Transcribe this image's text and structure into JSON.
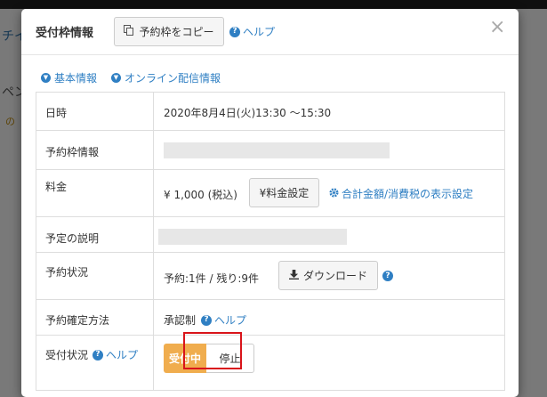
{
  "background": {
    "fragments": [
      "チイ",
      "ペン",
      "の"
    ]
  },
  "modal": {
    "title": "受付枠情報",
    "copy_button": "予約枠をコピー",
    "help_label": "ヘルプ",
    "close_symbol": "×",
    "anchor_links": [
      "基本情報",
      "オンライン配信情報"
    ]
  },
  "table": {
    "datetime": {
      "label": "日時",
      "value": "2020年8月4日(火)13:30 ～15:30"
    },
    "slot_info": {
      "label": "予約枠情報"
    },
    "fee": {
      "label": "料金",
      "amount": "¥ 1,000 (税込)",
      "fee_settings_button": "¥料金設定",
      "display_settings_link": "合計金額/消費税の表示設定"
    },
    "description": {
      "label": "予定の説明"
    },
    "reservation_status": {
      "label": "予約状況",
      "value": "予約:1件 / 残り:9件",
      "download_button": "ダウンロード"
    },
    "confirmation_method": {
      "label": "予約確定方法",
      "value": "承認制",
      "help_label": "ヘルプ"
    },
    "acceptance_status": {
      "label": "受付状況",
      "help_label": "ヘルプ",
      "active_state": "受付中",
      "stop_button": "停止"
    }
  },
  "colors": {
    "link": "#2f7fc3",
    "accepting": "#f0ad4e",
    "highlight": "#d9141a"
  }
}
